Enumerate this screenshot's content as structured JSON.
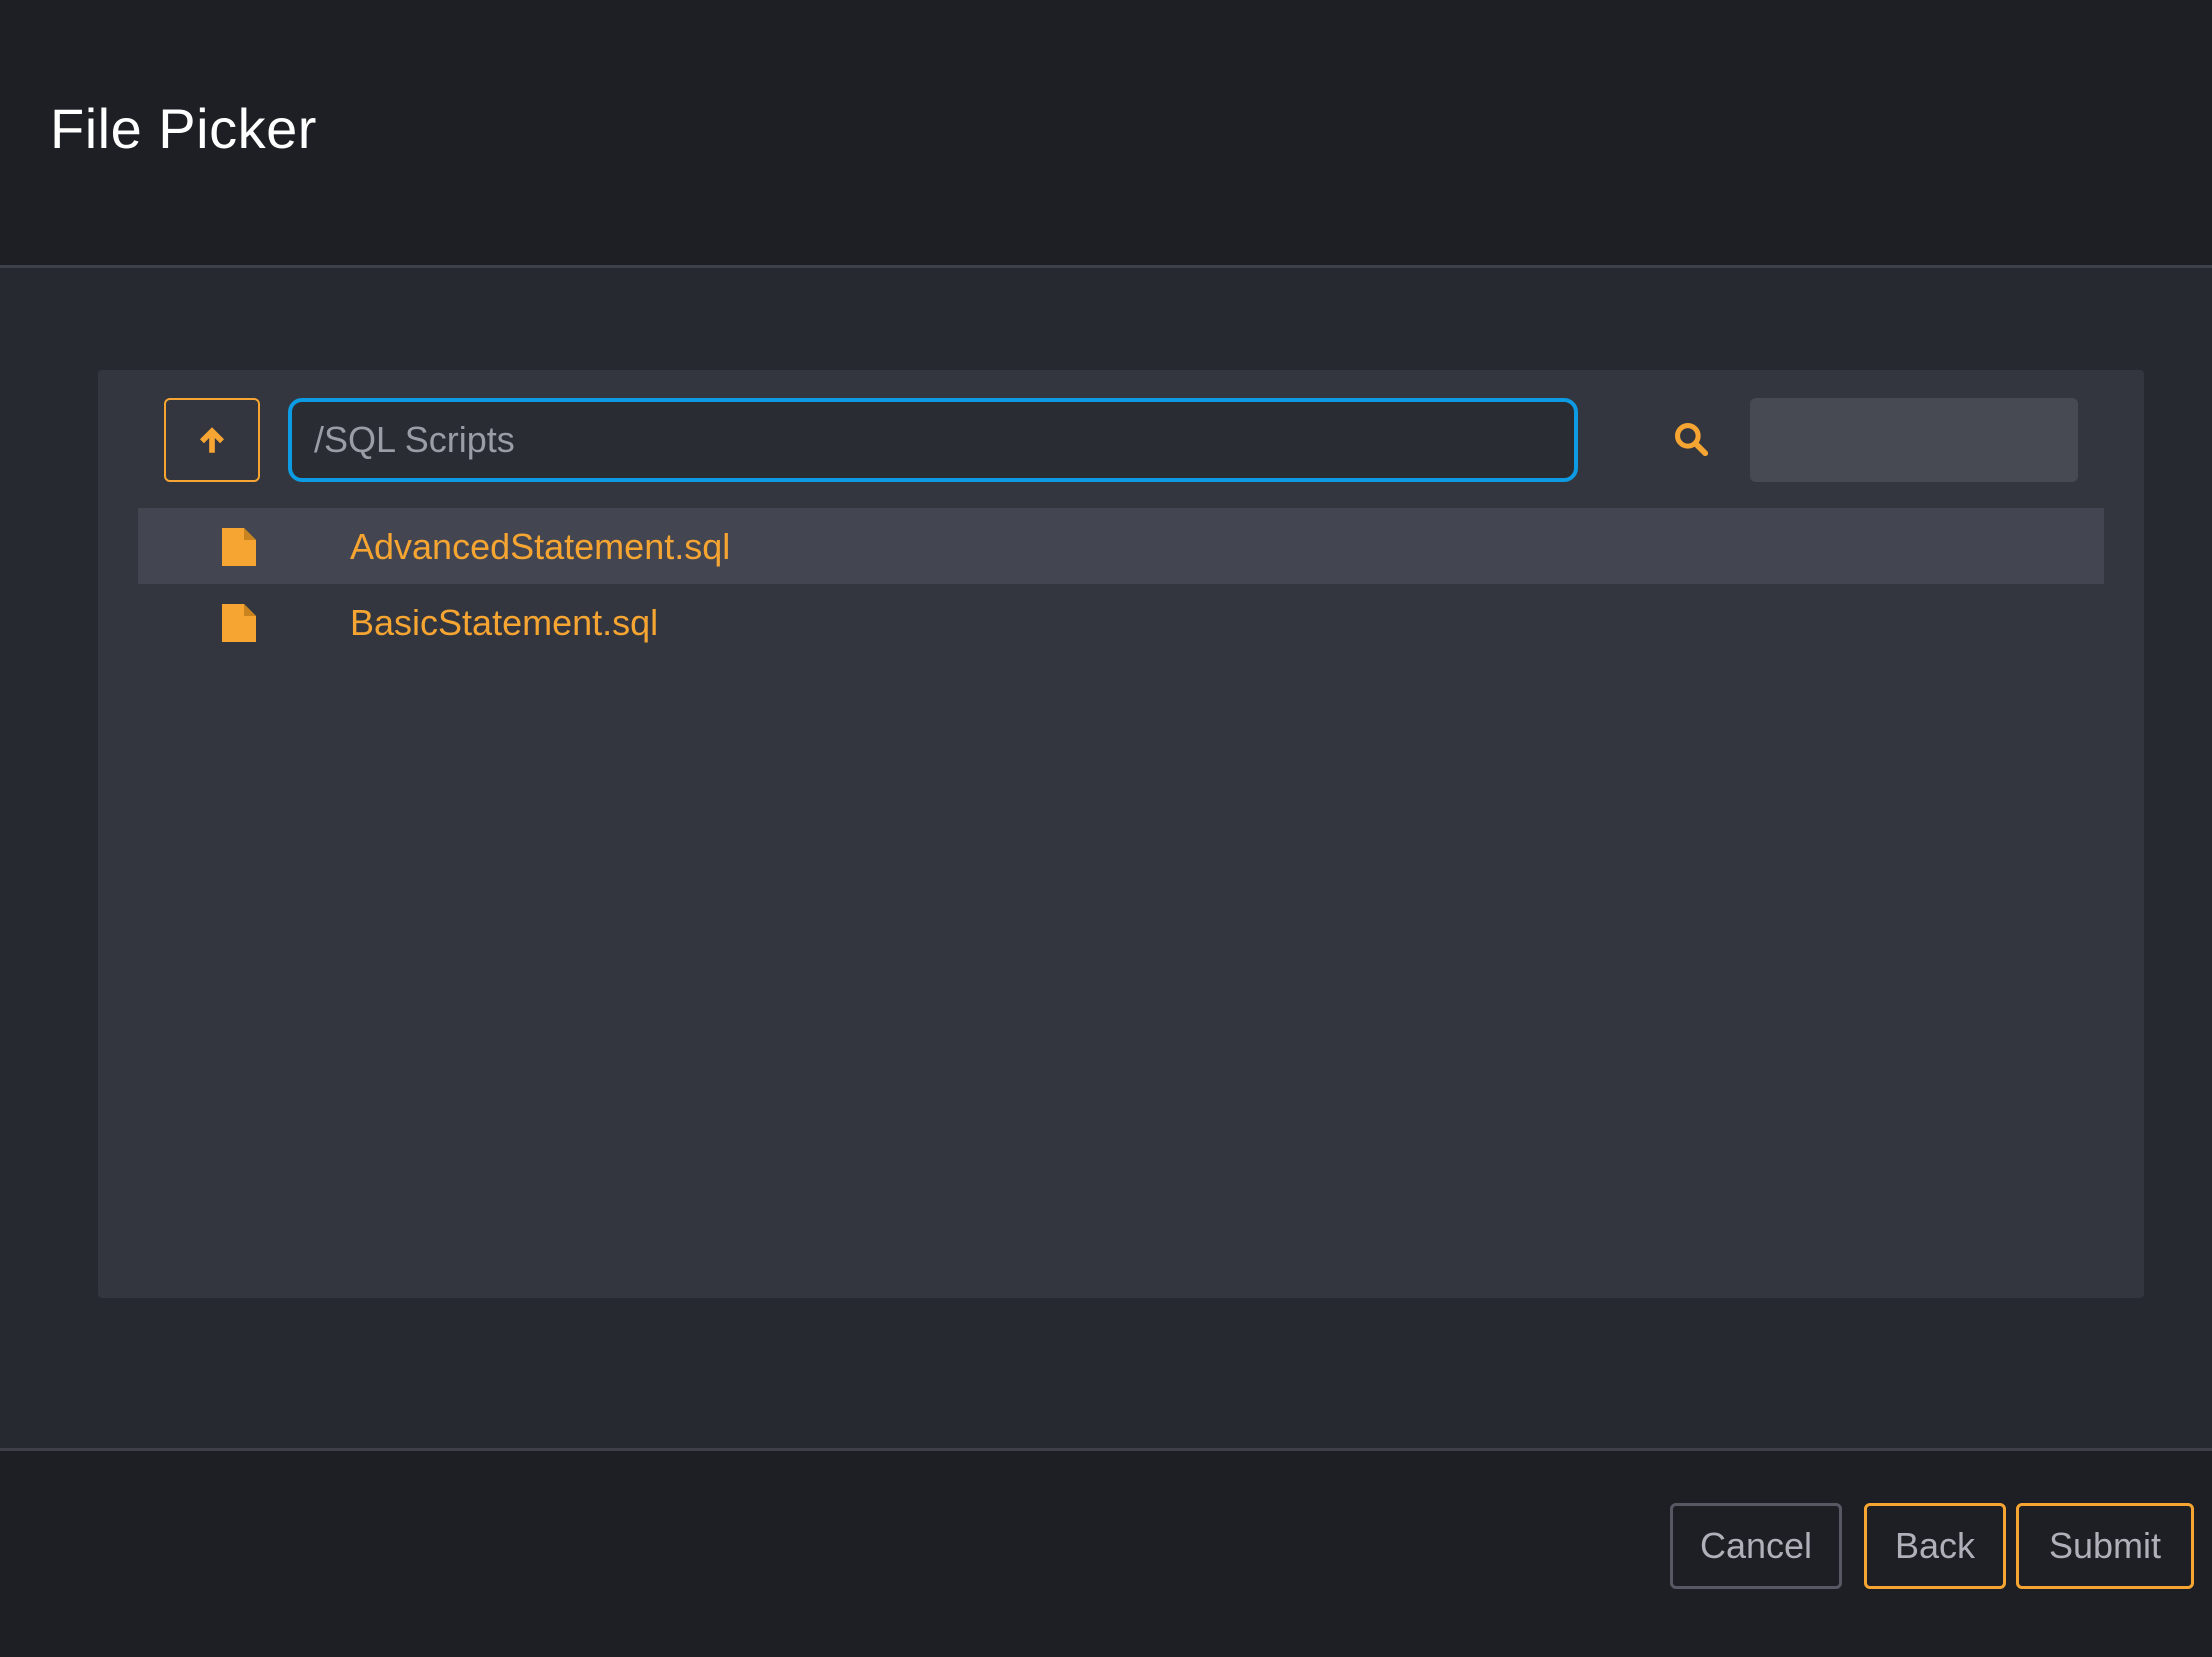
{
  "dialog": {
    "title": "File Picker"
  },
  "toolbar": {
    "up_icon": "arrow-up-icon",
    "path_value": "/SQL Scripts",
    "search_icon": "search-icon",
    "search_value": ""
  },
  "files": [
    {
      "name": "AdvancedStatement.sql",
      "icon": "file-icon",
      "selected": true
    },
    {
      "name": "BasicStatement.sql",
      "icon": "file-icon",
      "selected": false
    }
  ],
  "footer": {
    "cancel_label": "Cancel",
    "back_label": "Back",
    "submit_label": "Submit"
  },
  "colors": {
    "accent": "#f6a532",
    "focus": "#0d9ce3",
    "background": "#1e1f24",
    "panel": "#33363f"
  }
}
